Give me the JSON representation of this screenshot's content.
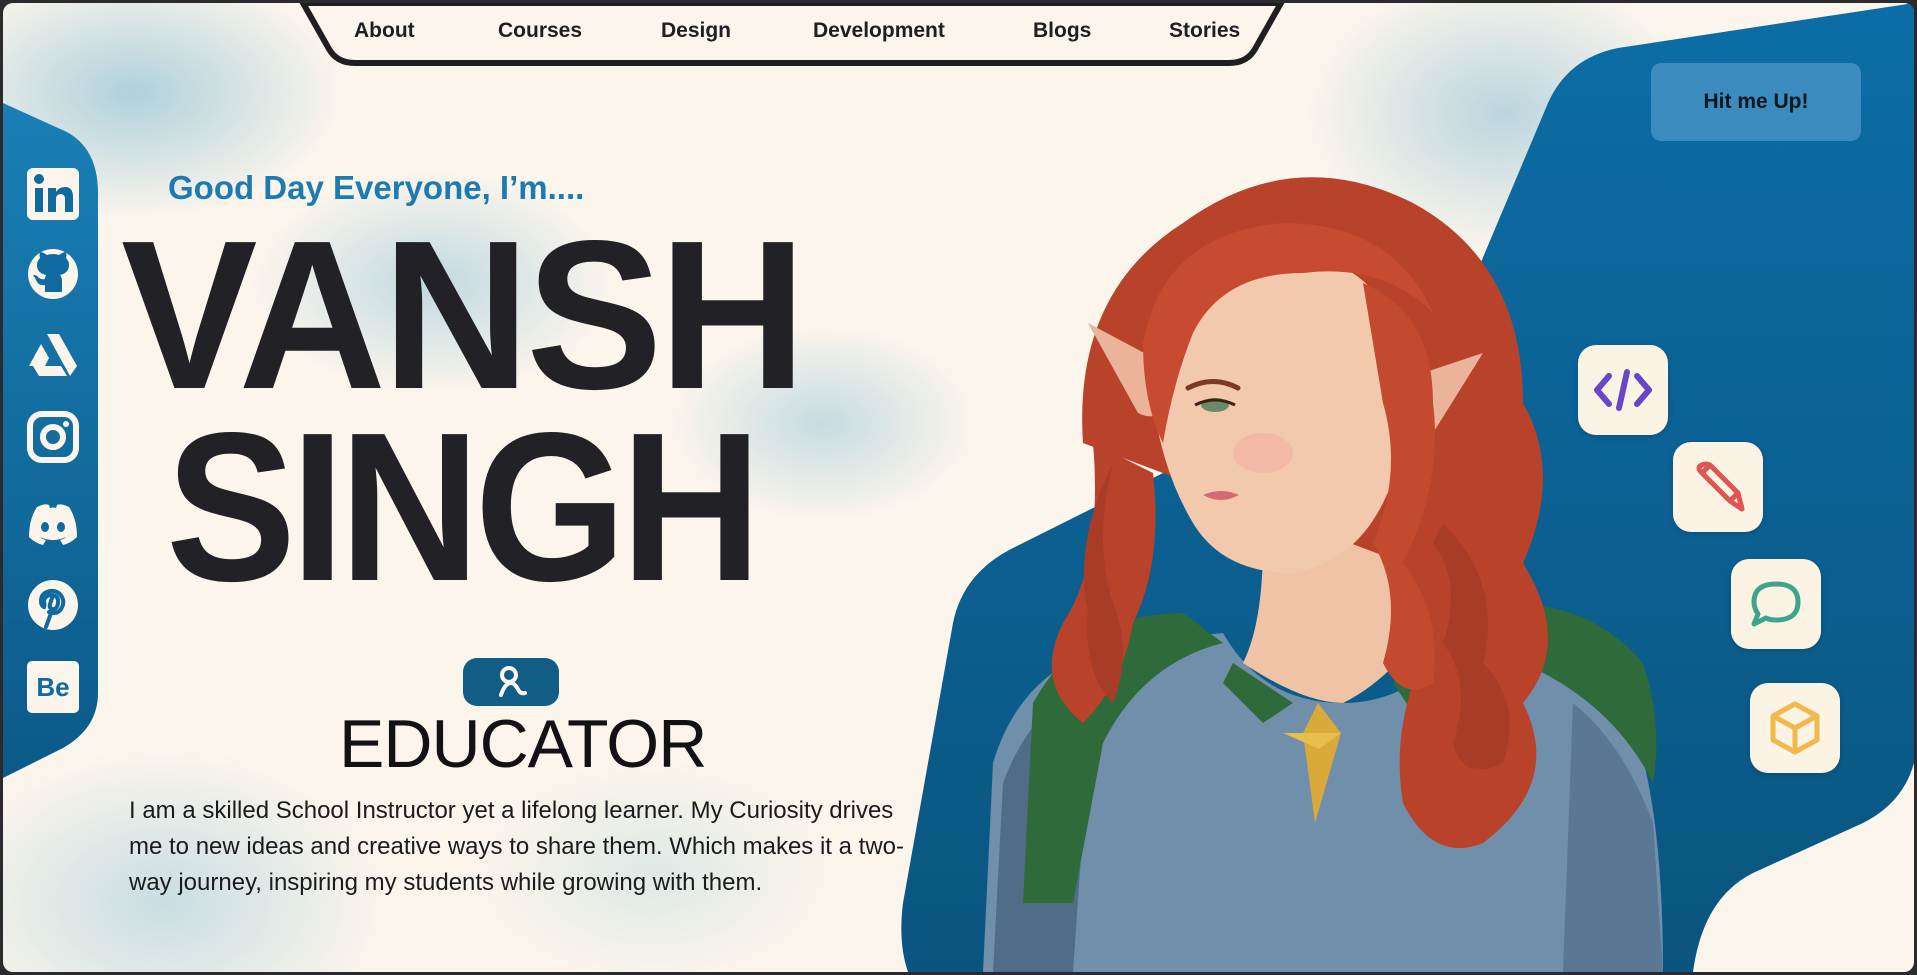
{
  "nav": {
    "items": [
      {
        "label": "About"
      },
      {
        "label": "Courses"
      },
      {
        "label": "Design"
      },
      {
        "label": "Development"
      },
      {
        "label": "Blogs"
      },
      {
        "label": "Stories"
      }
    ]
  },
  "cta": {
    "label": "Hit me Up!"
  },
  "hero": {
    "greeting": "Good Day Everyone, I’m....",
    "first_name": "VANSH",
    "last_name": "SINGH",
    "role_icon": "user-icon",
    "role": "EDUCATOR",
    "description": "I am a skilled School Instructor yet a lifelong learner. My Curiosity drives me to new ideas and creative ways to share them. Which makes it a two-way journey, inspiring my students while growing with them."
  },
  "social": [
    {
      "icon": "linkedin-icon"
    },
    {
      "icon": "github-icon"
    },
    {
      "icon": "artstation-icon"
    },
    {
      "icon": "instagram-icon"
    },
    {
      "icon": "discord-icon"
    },
    {
      "icon": "pinterest-icon"
    },
    {
      "icon": "behance-icon",
      "text": "Be"
    }
  ],
  "skills": [
    {
      "icon": "code-icon",
      "color": "#6a45c6"
    },
    {
      "icon": "pencil-icon",
      "color": "#e2544f"
    },
    {
      "icon": "chat-icon",
      "color": "#3fa58a"
    },
    {
      "icon": "cube-icon",
      "color": "#f2b84c"
    }
  ],
  "colors": {
    "accent_blue": "#0f6aa0",
    "background": "#fbf5ec",
    "text_dark": "#222126"
  }
}
